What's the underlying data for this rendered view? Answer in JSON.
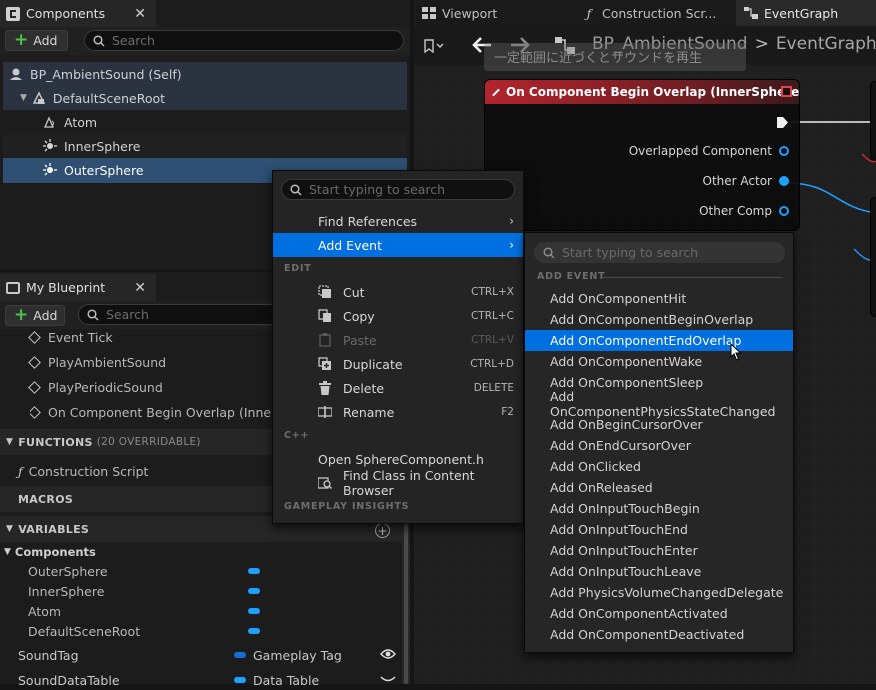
{
  "components_panel": {
    "title": "Components",
    "add_label": "Add",
    "search_placeholder": "Search",
    "tree": [
      {
        "label": "BP_AmbientSound (Self)",
        "icon": "self-icon"
      },
      {
        "label": "DefaultSceneRoot",
        "icon": "scene-root-icon"
      },
      {
        "label": "Atom",
        "icon": "atom-icon"
      },
      {
        "label": "InnerSphere",
        "icon": "sphere-icon"
      },
      {
        "label": "OuterSphere",
        "icon": "sphere-icon"
      }
    ]
  },
  "my_blueprint": {
    "title": "My Blueprint",
    "add_label": "Add",
    "search_placeholder": "Search",
    "events": [
      "Event Tick",
      "PlayAmbientSound",
      "PlayPeriodicSound",
      "On Component Begin Overlap (InnerSph"
    ],
    "functions_label": "FUNCTIONS",
    "functions_count": "(20 OVERRIDABLE)",
    "construction_script": "Construction Script",
    "macros_label": "MACROS",
    "variables_label": "VARIABLES",
    "components_label": "Components",
    "component_vars": [
      "OuterSphere",
      "InnerSphere",
      "Atom",
      "DefaultSceneRoot"
    ],
    "sound_tag": {
      "name": "SoundTag",
      "type": "Gameplay Tag"
    },
    "sound_data_table": {
      "name": "SoundDataTable",
      "type": "Data Table"
    }
  },
  "editor_tabs": [
    {
      "label": "Viewport",
      "icon": "viewport-icon"
    },
    {
      "label": "Construction Scr...",
      "icon": "function-icon"
    },
    {
      "label": "EventGraph",
      "icon": "graph-icon"
    }
  ],
  "breadcrumb": {
    "blueprint": "BP_AmbientSound",
    "separator": ">",
    "graph": "EventGraph"
  },
  "comment_text": "一定範囲に近づくとサウンドを再生",
  "node": {
    "title": "On Component Begin Overlap (InnerSphere)",
    "pins": [
      "Overlapped Component",
      "Other Actor",
      "Other Comp"
    ]
  },
  "context_menu": {
    "search_placeholder": "Start typing to search",
    "find_references": "Find References",
    "add_event": "Add Event",
    "edit_header": "EDIT",
    "items": [
      {
        "label": "Cut",
        "shortcut": "CTRL+X",
        "icon": "cut-icon"
      },
      {
        "label": "Copy",
        "shortcut": "CTRL+C",
        "icon": "copy-icon"
      },
      {
        "label": "Paste",
        "shortcut": "CTRL+V",
        "icon": "paste-icon"
      },
      {
        "label": "Duplicate",
        "shortcut": "CTRL+D",
        "icon": "duplicate-icon"
      },
      {
        "label": "Delete",
        "shortcut": "DELETE",
        "icon": "delete-icon"
      },
      {
        "label": "Rename",
        "shortcut": "F2",
        "icon": "rename-icon"
      }
    ],
    "cpp_header": "C++",
    "open_header": "Open SphereComponent.h",
    "find_class": "Find Class in Content Browser",
    "gameplay_header": "GAMEPLAY INSIGHTS"
  },
  "add_event_submenu": {
    "search_placeholder": "Start typing to search",
    "header": "ADD EVENT",
    "items": [
      "Add OnComponentHit",
      "Add OnComponentBeginOverlap",
      "Add OnComponentEndOverlap",
      "Add OnComponentWake",
      "Add OnComponentSleep",
      "Add OnComponentPhysicsStateChanged",
      "Add OnBeginCursorOver",
      "Add OnEndCursorOver",
      "Add OnClicked",
      "Add OnReleased",
      "Add OnInputTouchBegin",
      "Add OnInputTouchEnd",
      "Add OnInputTouchEnter",
      "Add OnInputTouchLeave",
      "Add PhysicsVolumeChangedDelegate",
      "Add OnComponentActivated",
      "Add OnComponentDeactivated"
    ],
    "highlighted_index": 2
  },
  "colors": {
    "accent": "#0070e0",
    "selection": "#2f4f73",
    "pin_blue": "#1ea0ff",
    "node_red": "#b3242c"
  }
}
